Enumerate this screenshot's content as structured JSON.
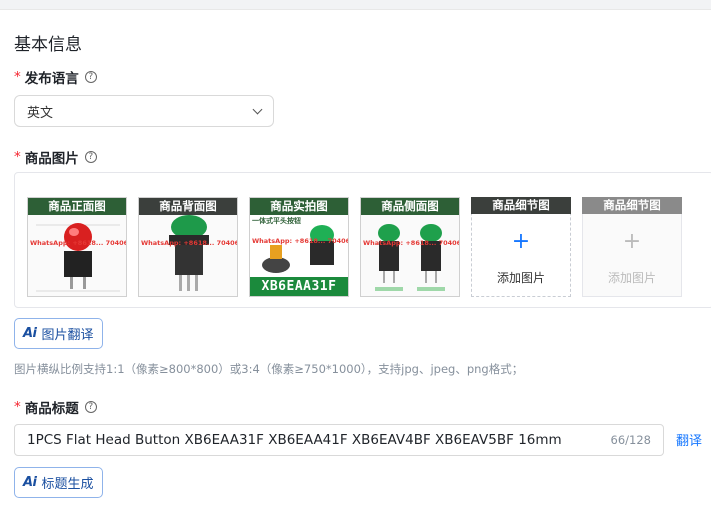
{
  "section_title": "基本信息",
  "language": {
    "label": "发布语言",
    "required_mark": "*",
    "help": "?",
    "selected": "英文"
  },
  "images": {
    "label": "商品图片",
    "required_mark": "*",
    "help": "?",
    "thumbnails": [
      {
        "title": "商品正面图",
        "watermark": "WhatsApp: +8618... 7040688"
      },
      {
        "title": "商品背面图",
        "watermark": "WhatsApp: +8618... 7040688"
      },
      {
        "title": "商品实拍图",
        "watermark": "WhatsApp: +8618... 7040688",
        "overlay_text": "XB6EAA31F",
        "banner": "一体式平头按钮"
      },
      {
        "title": "商品侧面图",
        "watermark": "WhatsApp: +8618... 7040688"
      }
    ],
    "add_tiles": [
      {
        "title": "商品细节图",
        "add_text": "添加图片",
        "plus": "+"
      },
      {
        "title": "商品细节图",
        "add_text": "添加图片",
        "plus": "+"
      }
    ],
    "translate_button": "图片翻译",
    "ai_mark": "Ai",
    "hint": "图片横纵比例支持1:1（像素≥800*800）或3:4（像素≥750*1000），支持jpg、jpeg、png格式；"
  },
  "product_title": {
    "label": "商品标题",
    "required_mark": "*",
    "help": "?",
    "value": "1PCS Flat Head Button XB6EAA31F XB6EAA41F XB6EAV4BF XB6EAV5BF 16mm",
    "counter": "66/128",
    "translate_link": "翻译",
    "generate_button": "标题生成",
    "ai_mark": "Ai"
  },
  "colors": {
    "accent": "#1677ff",
    "required": "#f5222d",
    "thumb_header_dark": "#3b3f3c",
    "thumb_header_green": "#2d5f36"
  }
}
